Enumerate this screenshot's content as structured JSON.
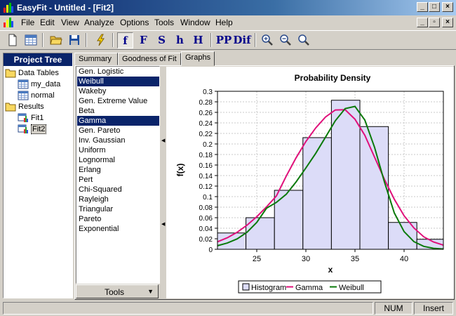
{
  "window": {
    "title": "EasyFit  - Untitled - [Fit2]",
    "caption_buttons": {
      "minimize": "_",
      "maximize": "□",
      "close": "×"
    }
  },
  "menu": [
    "File",
    "Edit",
    "View",
    "Analyze",
    "Options",
    "Tools",
    "Window",
    "Help"
  ],
  "toolbar": {
    "buttons": [
      {
        "name": "new-icon"
      },
      {
        "name": "table-icon"
      },
      {
        "name": "open-folder-icon"
      },
      {
        "name": "save-icon"
      },
      {
        "name": "lightning-icon"
      },
      {
        "label": "f"
      },
      {
        "label": "F"
      },
      {
        "label": "S"
      },
      {
        "label": "h"
      },
      {
        "label": "H"
      },
      {
        "label": "PP"
      },
      {
        "label": "Dif"
      },
      {
        "name": "zoom-in-icon"
      },
      {
        "name": "zoom-out-icon"
      },
      {
        "name": "zoom-reset-icon"
      }
    ]
  },
  "project_tree": {
    "title": "Project Tree",
    "data_tables_label": "Data Tables",
    "tables": [
      "my_data",
      "normal"
    ],
    "results_label": "Results",
    "fits": [
      "Fit1",
      "Fit2"
    ],
    "selected_fit": "Fit2"
  },
  "tabs": [
    "Summary",
    "Goodness of Fit",
    "Graphs"
  ],
  "active_tab": "Graphs",
  "distributions": [
    "Gen. Logistic",
    "Weibull",
    "Wakeby",
    "Gen. Extreme Value",
    "Beta",
    "Gamma",
    "Gen. Pareto",
    "Inv. Gaussian",
    "Uniform",
    "Lognormal",
    "Erlang",
    "Pert",
    "Chi-Squared",
    "Rayleigh",
    "Triangular",
    "Pareto",
    "Exponential"
  ],
  "selected_distributions": [
    "Weibull",
    "Gamma"
  ],
  "tools_button": "Tools",
  "chart_data": {
    "type": "bar",
    "title": "Probability Density",
    "xlabel": "x",
    "ylabel": "f(x)",
    "xlim": [
      21,
      44
    ],
    "ylim": [
      0,
      0.3
    ],
    "xticks": [
      25,
      30,
      35,
      40
    ],
    "yticks": [
      0,
      0.02,
      0.04,
      0.06,
      0.08,
      0.1,
      0.12,
      0.14,
      0.16,
      0.18,
      0.2,
      0.22,
      0.24,
      0.26,
      0.28,
      0.3
    ],
    "grid": true,
    "legend_position": "bottom",
    "histogram": {
      "name": "Histogram",
      "bins": [
        [
          21,
          23.9
        ],
        [
          23.9,
          26.8
        ],
        [
          26.8,
          29.7
        ],
        [
          29.7,
          32.6
        ],
        [
          32.6,
          35.5
        ],
        [
          35.5,
          38.4
        ],
        [
          38.4,
          41.3
        ],
        [
          41.3,
          44
        ]
      ],
      "values": [
        0.031,
        0.06,
        0.112,
        0.212,
        0.283,
        0.233,
        0.051,
        0.019
      ]
    },
    "series": [
      {
        "name": "Gamma",
        "color": "#e0107a",
        "x": [
          21,
          22,
          23,
          24,
          25,
          26,
          27,
          28,
          29,
          30,
          31,
          32,
          33,
          34,
          35,
          36,
          37,
          38,
          39,
          40,
          41,
          42,
          43,
          44
        ],
        "y": [
          0.0142,
          0.0219,
          0.0323,
          0.0457,
          0.0619,
          0.0806,
          0.1012,
          0.1389,
          0.1736,
          0.2047,
          0.2304,
          0.2512,
          0.2646,
          0.2649,
          0.2469,
          0.2165,
          0.1746,
          0.1328,
          0.0952,
          0.0638,
          0.0406,
          0.0237,
          0.0139,
          0.0079
        ]
      },
      {
        "name": "Weibull",
        "color": "#0a7a0a",
        "x": [
          21,
          22,
          23,
          24,
          25,
          26,
          27,
          28,
          29,
          30,
          31,
          32,
          33,
          34,
          35,
          36,
          37,
          38,
          39,
          40,
          41,
          42,
          43,
          44
        ],
        "y": [
          0.0068,
          0.0119,
          0.0198,
          0.0322,
          0.0511,
          0.0781,
          0.0891,
          0.1044,
          0.1279,
          0.1544,
          0.1821,
          0.2129,
          0.2441,
          0.2672,
          0.2714,
          0.2455,
          0.1932,
          0.1278,
          0.0692,
          0.0336,
          0.0145,
          0.0056,
          0.0019,
          0.0006
        ]
      }
    ]
  },
  "status": {
    "num": "NUM",
    "insert": "Insert"
  }
}
